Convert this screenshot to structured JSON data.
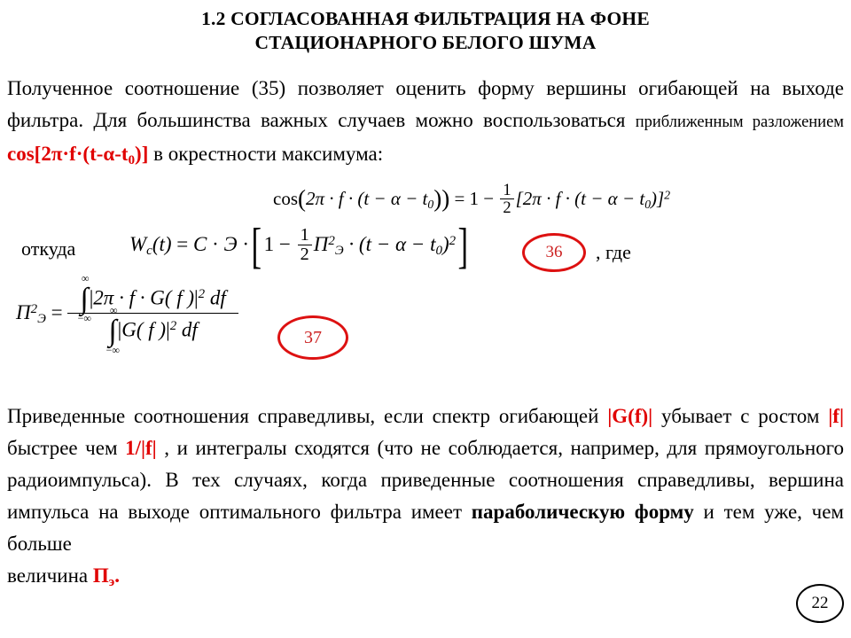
{
  "document": {
    "page_number": "22",
    "accent_red": "#e00000",
    "callout_red": "#dd1111",
    "text_color": "#000000",
    "background": "#ffffff"
  },
  "title": {
    "line1": "1.2 СОГЛАСОВАННАЯ ФИЛЬТРАЦИЯ НА ФОНЕ",
    "line2": "СТАЦИОНАРНОГО БЕЛОГО ШУМА"
  },
  "paragraph_top": {
    "seg1": "Полученное соотношение (35) позволяет оценить форму вершины огибающей на выходе фильтра. Для большинства важных случаев можно воспользоваться ",
    "seg2_small": "приближенным разложением ",
    "seg3_red": "cos[2π·f·(t-α-t",
    "seg3_red_sub": "0",
    "seg3_red_tail": ")]",
    "seg4": " в окрестности максимума:"
  },
  "equation_cos": {
    "lhs_fn": "cos",
    "lhs_body": "2π · f · (t − α − t",
    "lhs_sub": "0",
    "lhs_close": "))",
    "eq": "= 1 −",
    "frac_num": "1",
    "frac_den": "2",
    "rhs_open": "[2π · f · (t − α − t",
    "rhs_sub": "0",
    "rhs_close": ")]",
    "rhs_pow": "2"
  },
  "label_otkuda": "откуда",
  "label_gde": ", где",
  "equation_wc": {
    "fn": "W",
    "fn_sub": "c",
    "fn_arg": "(t)",
    "eq": "=",
    "c": "C",
    "dot1": "·",
    "e": "Э",
    "dot2": "·",
    "one": "1 −",
    "frac_num": "1",
    "frac_den": "2",
    "pi_sym": "П",
    "pi_sup": "2",
    "pi_sub": "Э",
    "tail": "· (t − α − t",
    "tail_sub": "0",
    "tail_close": ")",
    "tail_pow": "2",
    "number": "36"
  },
  "equation_pi": {
    "lhs": "П",
    "lhs_sup": "2",
    "lhs_sub": "Э",
    "eq": "=",
    "num_limit_top": "∞",
    "num_limit_bottom": "−∞",
    "num_integrand": "2π · f · G( f )",
    "num_pow": "2",
    "num_diff": "df",
    "den_limit_top": "∞",
    "den_limit_bottom": "−∞",
    "den_integrand": "G( f )",
    "den_pow": "2",
    "den_diff": "df",
    "number": "37"
  },
  "paragraph_bottom": {
    "seg1": "Приведенные соотношения справедливы, если спектр огибающей ",
    "seg2_red": "|G(f)|",
    "seg3": " убывает с ростом ",
    "seg4_red": "|f|",
    "seg5": " быстрее чем ",
    "seg6_red": "1/|f|",
    "seg7": " , и интегралы сходятся (что не соблюдается, например, для прямоугольного радиоимпульса). В тех случаях, когда приведенные соотношения справедливы, вершина импульса на выходе оптимального фильтра имеет ",
    "seg8_bold": "параболическую форму",
    "seg9": " и тем уже, чем больше",
    "seg10": "величина ",
    "seg11_red": "П",
    "seg11_red_sub": "э",
    "seg12_red": "."
  }
}
